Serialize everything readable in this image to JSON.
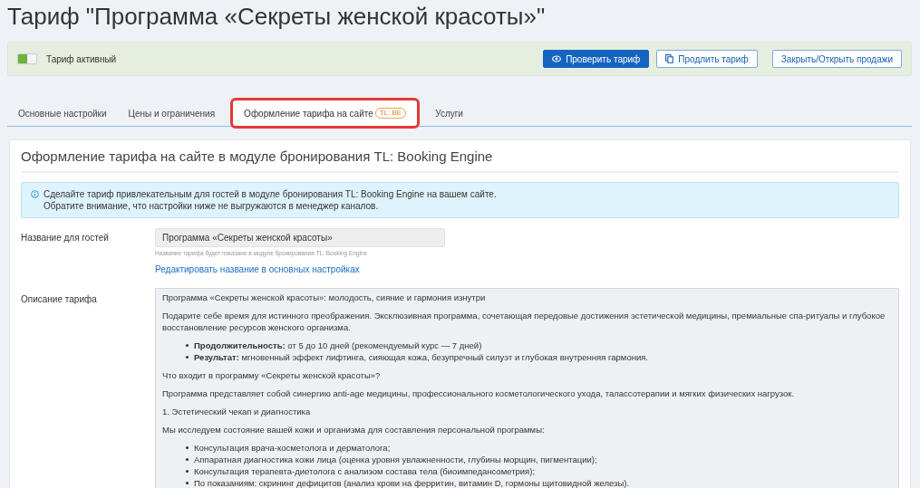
{
  "page_title": "Тариф \"Программа «Секреты женской красоты»\"",
  "status_bar": {
    "toggle_on": true,
    "label": "Тариф активный",
    "buttons": [
      {
        "label": "Проверить тариф",
        "kind": "primary"
      },
      {
        "label": "Продлить тариф",
        "kind": "copy"
      },
      {
        "label": "Закрыть/Открыть продажи",
        "kind": "plain"
      }
    ]
  },
  "tabs": [
    {
      "label": "Основные настройки",
      "selected": false,
      "highlighted": false
    },
    {
      "label": "Цены и ограничения",
      "selected": false,
      "highlighted": false
    },
    {
      "label": "Оформление тарифа на сайте",
      "badge": "TL: BE",
      "selected": true,
      "highlighted": true
    },
    {
      "label": "Услуги",
      "selected": false,
      "highlighted": false
    }
  ],
  "section": {
    "heading": "Оформление тарифа на сайте в модуле бронирования TL: Booking Engine",
    "info": [
      "Сделайте тариф привлекательным для гостей в модуле бронирования TL: Booking Engine на вашем сайте.",
      "Обратите внимание, что настройки ниже не выгружаются в менеджер каналов."
    ],
    "guest_name": {
      "label": "Название для гостей",
      "value": "Программа «Секреты женской красоты»",
      "hint": "Название тарифа будет показано в модуле бронирования TL: Booking Engine",
      "link": "Редактировать название в основных настройках"
    },
    "description": {
      "label": "Описание тарифа",
      "blocks": [
        {
          "kind": "paragraph",
          "text": "Программа «Секреты женской красоты»: молодость, сияние и гармония изнутри"
        },
        {
          "kind": "paragraph",
          "text": "Подарите себе время для истинного преображения. Эксклюзивная программа, сочетающая передовые достижения эстетической медицины, премиальные спа-ритуалы и глубокое восстановление ресурсов женского организма."
        },
        {
          "kind": "list",
          "items": [
            "**Продолжительность:** от 5 до 10 дней (рекомендуемый курс — 7 дней)",
            "**Результат:** мгновенный эффект лифтинга, сияющая кожа, безупречный силуэт и глубокая внутренняя гармония."
          ]
        },
        {
          "kind": "paragraph",
          "text": "Что входит в программу «Секреты женской красоты»?"
        },
        {
          "kind": "paragraph",
          "text": "Программа представляет собой синергию anti-age медицины, профессионального косметологического ухода, талассотерапии и мягких физических нагрузок."
        },
        {
          "kind": "paragraph",
          "text": "1. Эстетический чекап и диагностика"
        },
        {
          "kind": "paragraph",
          "text": "Мы исследуем состояние вашей кожи и организма для составления персональной программы:"
        },
        {
          "kind": "list",
          "items": [
            "Консультация врача-косметолога и дерматолога;",
            "Аппаратная диагностика кожи лица (оценка уровня увлажненности, глубины морщин, пигментации);",
            "Консультация терапевта-диетолога с анализом состава тела (биоимпедансометрия);",
            "По показаниям: скрининг дефицитов (анализ крови на ферритин, витамин D, гормоны щитовидной железы)."
          ]
        }
      ]
    }
  }
}
